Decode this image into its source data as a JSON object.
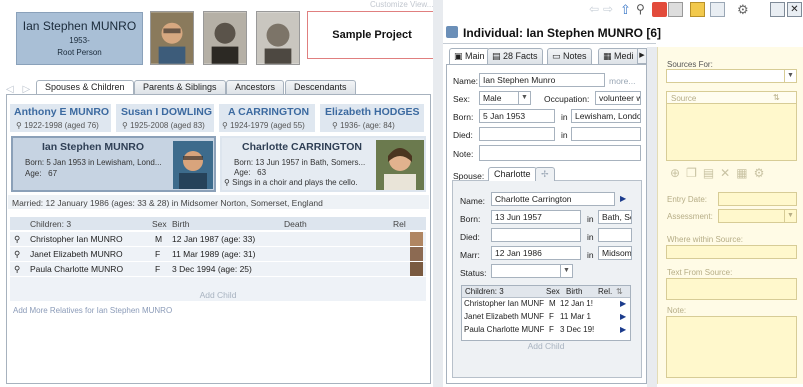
{
  "root_person": {
    "name": "Ian Stephen MUNRO",
    "year": "1953-",
    "role": "Root Person"
  },
  "customize_view": "Customize View...",
  "project_name": "Sample Project",
  "left_tabs": [
    "Spouses & Children",
    "Parents & Siblings",
    "Ancestors",
    "Descendants"
  ],
  "ancestors": [
    {
      "name": "Anthony E MUNRO",
      "dates": "1922-1998 (aged 76)"
    },
    {
      "name": "Susan I DOWLING",
      "dates": "1925-2008 (aged 83)"
    },
    {
      "name": "A CARRINGTON",
      "dates": "1924-1979 (aged 55)"
    },
    {
      "name": "Elizabeth HODGES",
      "dates": "1936- (age: 84)"
    }
  ],
  "focus_person": {
    "name": "Ian Stephen MUNRO",
    "born_label": "Born:",
    "born": "5 Jan 1953 in Lewisham, Lond...",
    "age_label": "Age:",
    "age": "67"
  },
  "spouse_card": {
    "name": "Charlotte CARRINGTON",
    "born_label": "Born:",
    "born": "13 Jun 1957 in Bath, Somers...",
    "age_label": "Age:",
    "age": "63",
    "note": "Sings in a choir and plays the cello."
  },
  "married_text": "Married: 12 January 1986 (ages: 33 & 28) in Midsomer Norton, Somerset, England",
  "children_table": {
    "headers": {
      "children": "Children: 3",
      "sex": "Sex",
      "birth": "Birth",
      "death": "Death",
      "rel": "Rel"
    },
    "rows": [
      {
        "name": "Christopher Ian MUNRO",
        "sex": "M",
        "birth": "12 Jan 1987 (age: 33)"
      },
      {
        "name": "Janet Elizabeth MUNRO",
        "sex": "F",
        "birth": "11 Mar 1989 (age: 31)"
      },
      {
        "name": "Paula Charlotte MUNRO",
        "sex": "F",
        "birth": "3 Dec 1994 (age: 25)"
      }
    ],
    "add_child": "Add Child"
  },
  "add_more_relatives": "Add More Relatives for Ian Stephen MUNRO",
  "individual": {
    "title": "Individual: Ian Stephen MUNRO [6]",
    "tabs": [
      "Main",
      "Facts",
      "Notes",
      "Medi"
    ],
    "facts_count": "28",
    "name_label": "Name:",
    "name": "Ian Stephen Munro",
    "more": "more...",
    "sex_label": "Sex:",
    "sex": "Male",
    "occupation_label": "Occupation:",
    "occupation": "volunteer w",
    "born_label": "Born:",
    "born_date": "5 Jan 1953",
    "in_label": "in",
    "born_place": "Lewisham, Londo",
    "died_label": "Died:",
    "note_label": "Note:"
  },
  "spouse_panel": {
    "label": "Spouse:",
    "tab": "Charlotte",
    "name_label": "Name:",
    "name": "Charlotte Carrington",
    "born_label": "Born:",
    "born_date": "13 Jun 1957",
    "born_place": "Bath, Sc",
    "died_label": "Died:",
    "marr_label": "Marr:",
    "marr_date": "12 Jan 1986",
    "marr_place": "Midsom",
    "status_label": "Status:",
    "in_label": "in",
    "children_headers": {
      "children": "Children: 3",
      "sex": "Sex",
      "birth": "Birth",
      "rel": "Rel."
    },
    "children": [
      {
        "name": "Christopher Ian MUNF",
        "sex": "M",
        "birth": "12 Jan 1!"
      },
      {
        "name": "Janet Elizabeth MUNF",
        "sex": "F",
        "birth": "11 Mar 1"
      },
      {
        "name": "Paula Charlotte MUNF",
        "sex": "F",
        "birth": "3 Dec 19!"
      }
    ],
    "add_child": "Add Child"
  },
  "sources": {
    "sources_for_label": "Sources For:",
    "source_header": "Source",
    "entry_date_label": "Entry Date:",
    "assessment_label": "Assessment:",
    "where_label": "Where within Source:",
    "text_label": "Text From Source:",
    "note_label": "Note:"
  },
  "colors": {
    "accent": "#3c6aa0",
    "panel_blue": "#c6d3e2",
    "sources_bg": "#fffbe6"
  }
}
